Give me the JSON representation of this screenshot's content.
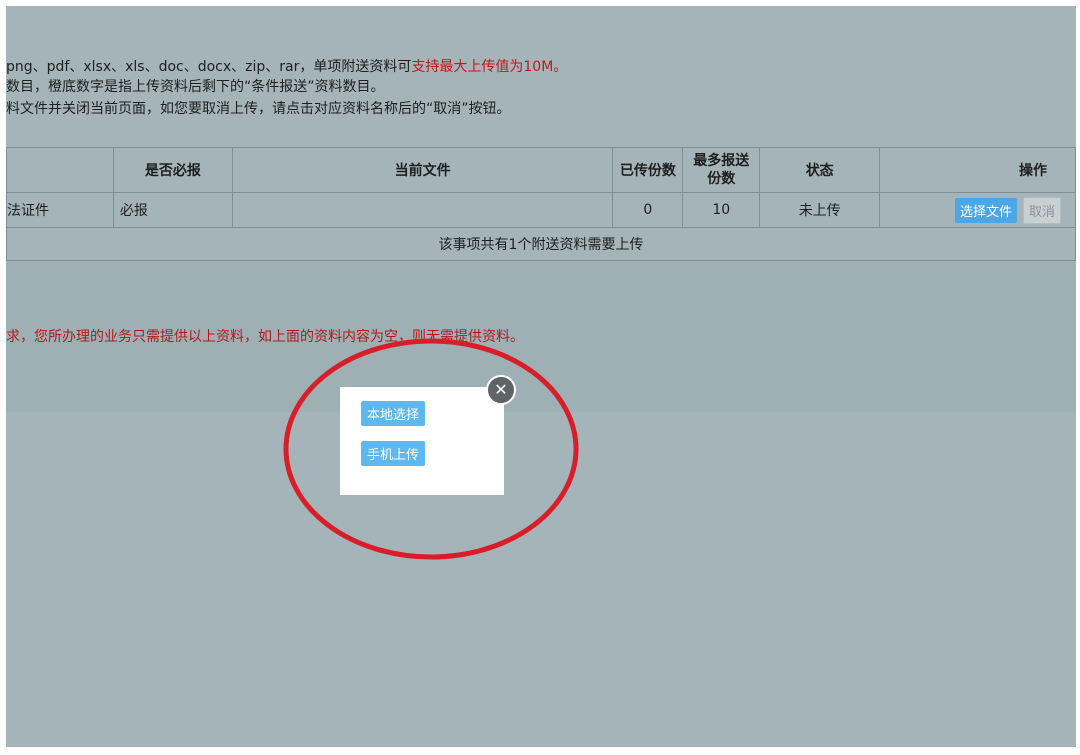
{
  "notices": {
    "line1_normal": "png、pdf、xlsx、xls、doc、docx、zip、rar，单项附送资料可",
    "line1_red": "支持最大上传值为10M。",
    "line2": "数目，橙底数字是指上传资料后剩下的“条件报送”资料数目。",
    "line3": "料文件并关闭当前页面，如您要取消上传，请点击对应资料名称后的“取消”按钮。"
  },
  "table": {
    "headers": {
      "required": "是否必报",
      "current_file": "当前文件",
      "uploaded": "已传份数",
      "max": "最多报送份数",
      "status": "状态",
      "action": "操作"
    },
    "row": {
      "name": "法证件",
      "required": "必报",
      "current_file": "",
      "uploaded": "0",
      "max": "10",
      "status": "未上传",
      "select_btn": "选择文件",
      "cancel_btn": "取消"
    },
    "summary": "该事项共有1个附送资料需要上传"
  },
  "note": "求，您所办理的业务只需提供以上资料，如上面的资料内容为空，则无需提供资料。",
  "popup": {
    "local_select": "本地选择",
    "mobile_upload": "手机上传",
    "close_symbol": "✕"
  },
  "colors": {
    "background": "#a4b4b8",
    "accent_red": "#c0181f",
    "primary_button": "#4da6e6",
    "annotation_circle": "#d81e28"
  }
}
